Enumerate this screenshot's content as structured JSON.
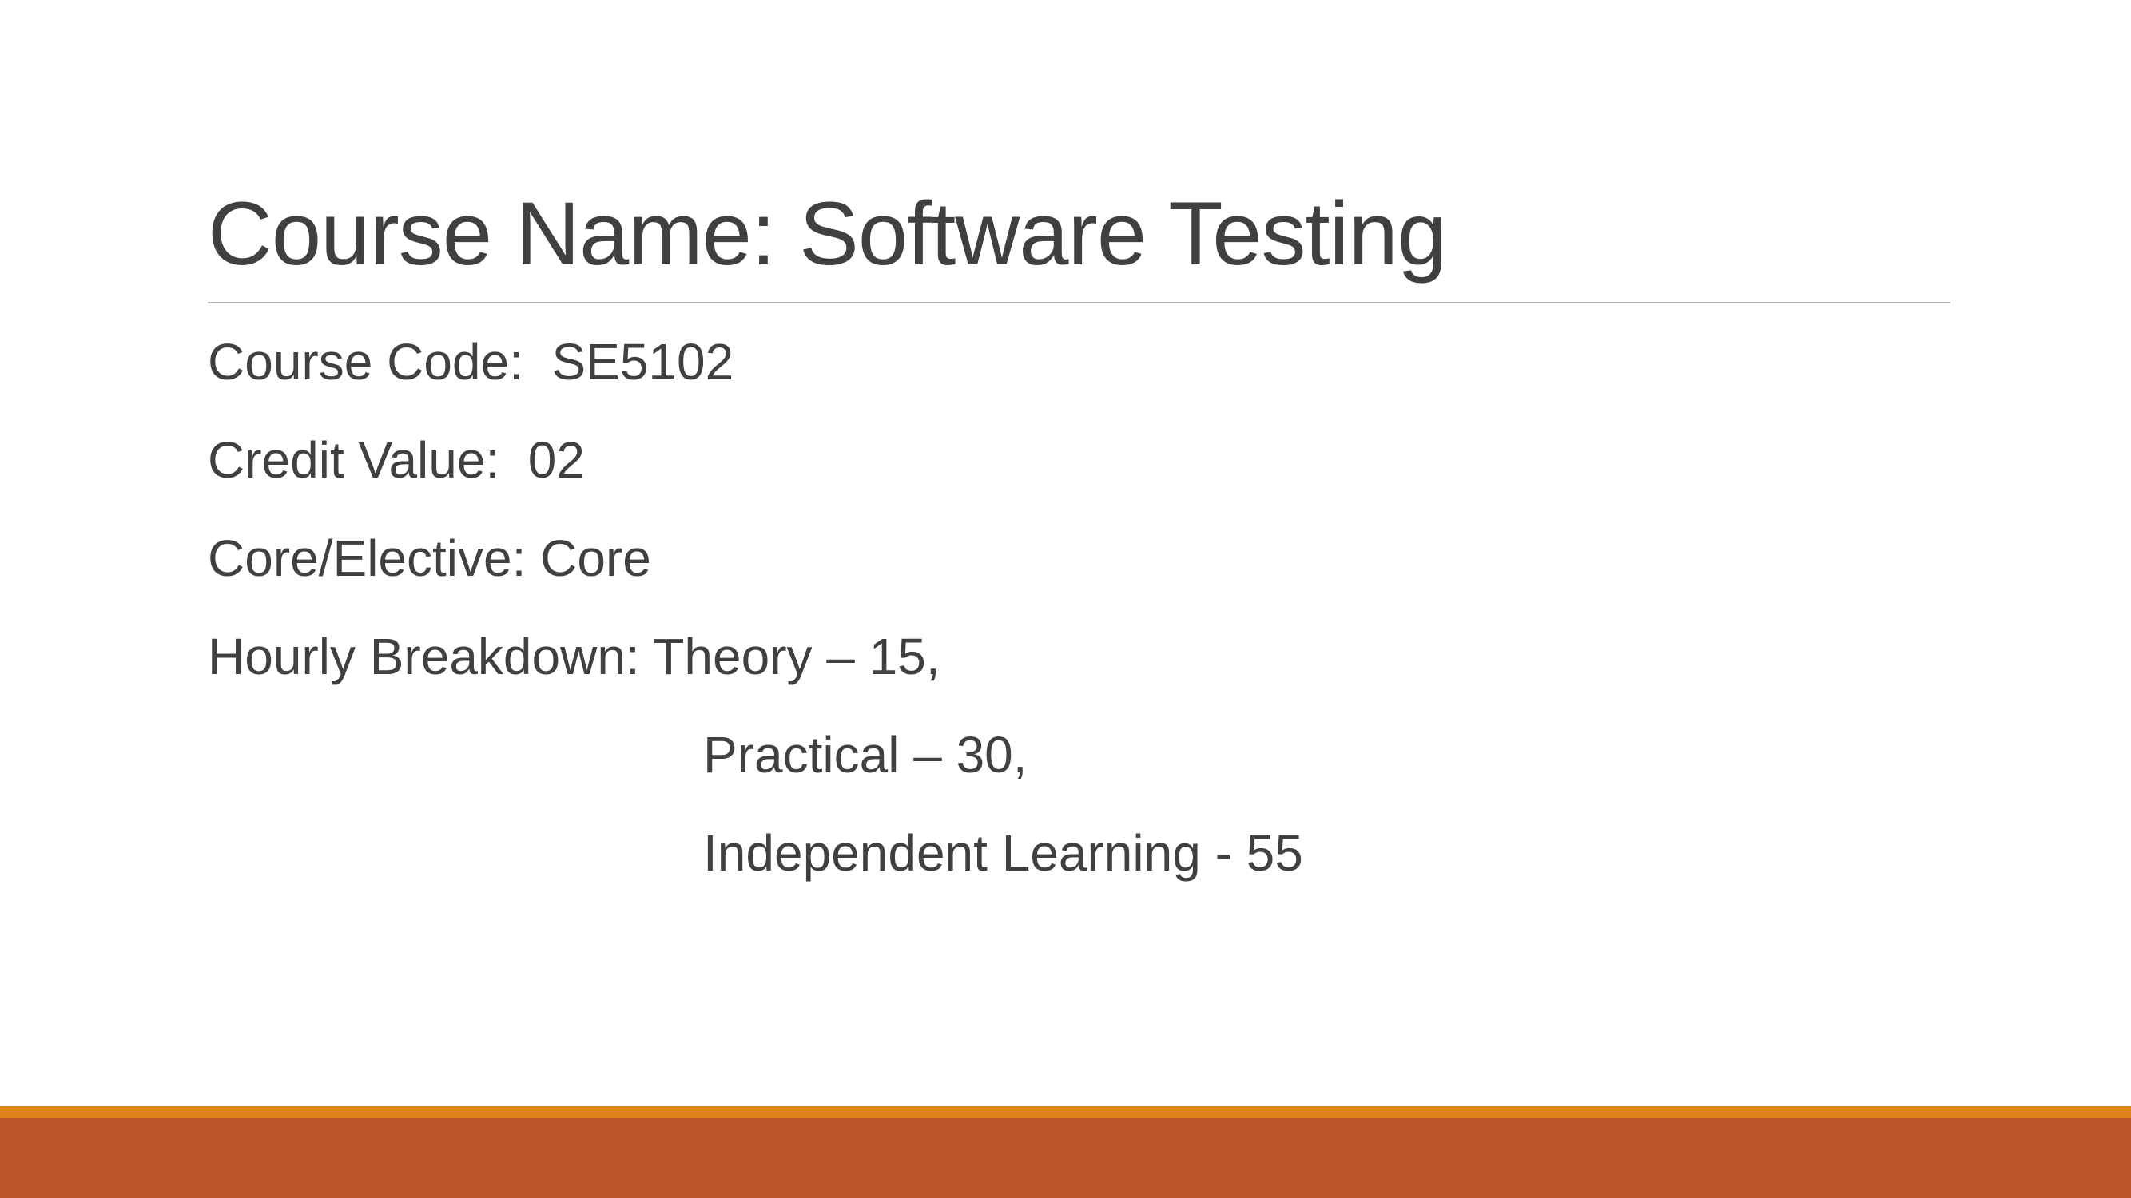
{
  "title": "Course Name:  Software Testing",
  "lines": {
    "course_code": "Course Code:  SE5102",
    "credit_value": "Credit Value:  02",
    "core_elective": "Core/Elective: Core",
    "hourly_breakdown": "Hourly Breakdown: Theory – 15,",
    "practical": "Practical – 30,",
    "independent": "Independent Learning - 55"
  },
  "colors": {
    "accent_stripe": "#E0821C",
    "footer_bar": "#BA562A",
    "text": "#404040",
    "rule": "#B5B5B5"
  }
}
